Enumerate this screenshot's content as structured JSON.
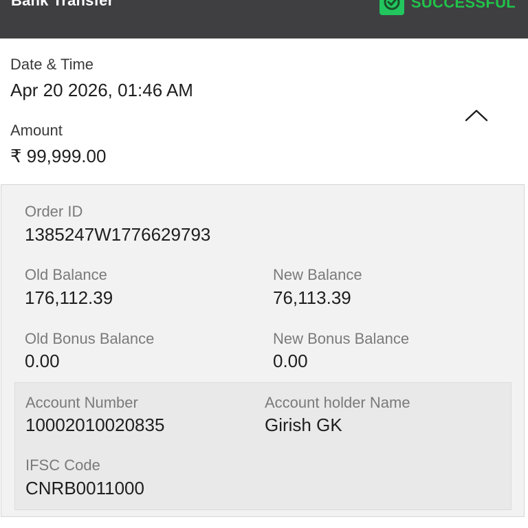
{
  "header": {
    "title": "Bank Transfer",
    "status_label": "SUCCESSFUL",
    "status_icon": "shield-check-icon",
    "status_color": "#21c34a",
    "background_color": "#3f3f41"
  },
  "summary": {
    "date_label": "Date & Time",
    "date_value": "Apr 20 2026, 01:46 AM",
    "amount_label": "Amount",
    "amount_value": "₹ 99,999.00",
    "toggle_icon": "chevron-up-icon"
  },
  "details": {
    "order_id_label": "Order ID",
    "order_id_value": "1385247W1776629793",
    "old_balance_label": "Old Balance",
    "old_balance_value": "176,112.39",
    "new_balance_label": "New Balance",
    "new_balance_value": "76,113.39",
    "old_bonus_label": "Old Bonus Balance",
    "old_bonus_value": "0.00",
    "new_bonus_label": "New Bonus Balance",
    "new_bonus_value": "0.00"
  },
  "bank": {
    "account_number_label": "Account Number",
    "account_number_value": "10002010020835",
    "holder_label": "Account holder Name",
    "holder_value": "Girish GK",
    "ifsc_label": "IFSC Code",
    "ifsc_value": "CNRB0011000"
  }
}
